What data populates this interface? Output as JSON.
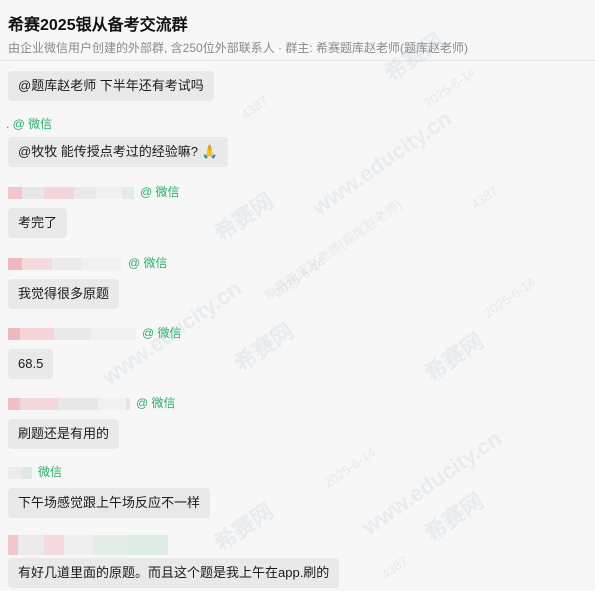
{
  "header": {
    "title": "希赛2025银从备考交流群",
    "subtitle": "由企业微信用户创建的外部群, 含250位外部联系人 · 群主: 希赛题库赵老师(题库赵老师)"
  },
  "messages": [
    {
      "sender": "",
      "text": "@题库赵老师  下半年还有考试吗"
    },
    {
      "sender": ". @ 微信",
      "text": "@牧牧 能传授点考过的经验嘛? 🙏"
    },
    {
      "sender": "@ 微信",
      "text": "考完了"
    },
    {
      "sender": "@ 微信",
      "text": "我觉得很多原题"
    },
    {
      "sender": "@ 微信",
      "text": "68.5"
    },
    {
      "sender": "@ 微信",
      "text": "刷题还是有用的"
    },
    {
      "sender": "微信",
      "text": "下午场感觉跟上午场反应不一样"
    },
    {
      "sender": "",
      "text": "有好几道里面的原题。而且这个题是我上午在app.刷的"
    }
  ],
  "watermark": {
    "brand": "希赛网",
    "url": "www.educity.cn",
    "tag": "希赛题库赵老师(题库赵老师)",
    "date": "2025-6-14",
    "code": "4387"
  }
}
